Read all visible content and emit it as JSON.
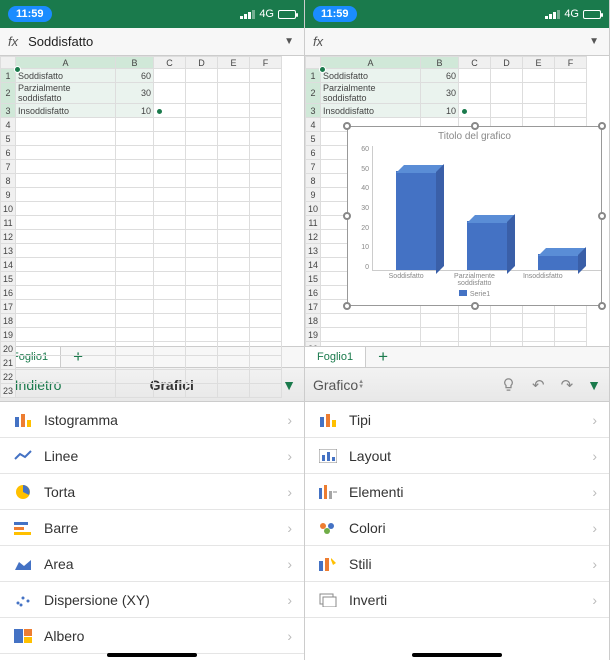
{
  "status": {
    "time": "11:59",
    "network": "4G"
  },
  "left": {
    "formula": "Soddisfatto",
    "sheet_name": "Foglio1",
    "columns": [
      "A",
      "B",
      "C",
      "D",
      "E",
      "F"
    ],
    "rows_visible": 23,
    "cells": {
      "A1": "Soddisfatto",
      "B1": "60",
      "A2": "Parzialmente soddisfatto",
      "B2": "30",
      "A3": "Insoddisfatto",
      "B3": "10"
    },
    "panel": {
      "back": "Indietro",
      "title": "Grafici",
      "items": [
        {
          "icon": "histogram",
          "label": "Istogramma"
        },
        {
          "icon": "line",
          "label": "Linee"
        },
        {
          "icon": "pie",
          "label": "Torta"
        },
        {
          "icon": "bar",
          "label": "Barre"
        },
        {
          "icon": "area",
          "label": "Area"
        },
        {
          "icon": "scatter",
          "label": "Dispersione (XY)"
        },
        {
          "icon": "tree",
          "label": "Albero"
        }
      ]
    }
  },
  "right": {
    "formula": "",
    "sheet_name": "Foglio1",
    "columns": [
      "A",
      "B",
      "C",
      "D",
      "E",
      "F"
    ],
    "rows_visible": 23,
    "cells": {
      "A1": "Soddisfatto",
      "B1": "60",
      "A2": "Parzialmente soddisfatto",
      "B2": "30",
      "A3": "Insoddisfatto",
      "B3": "10"
    },
    "chart": {
      "title": "Titolo del grafico",
      "legend": "Serie1"
    },
    "panel": {
      "title": "Grafico",
      "items": [
        {
          "icon": "histogram",
          "label": "Tipi"
        },
        {
          "icon": "layout",
          "label": "Layout"
        },
        {
          "icon": "elements",
          "label": "Elementi"
        },
        {
          "icon": "colors",
          "label": "Colori"
        },
        {
          "icon": "styles",
          "label": "Stili"
        },
        {
          "icon": "invert",
          "label": "Inverti"
        }
      ]
    }
  },
  "chart_data": {
    "type": "bar",
    "title": "Titolo del grafico",
    "categories": [
      "Soddisfatto",
      "Parzialmente soddisfatto",
      "Insoddisfatto"
    ],
    "series": [
      {
        "name": "Serie1",
        "values": [
          60,
          30,
          10
        ]
      }
    ],
    "ylim": [
      0,
      70
    ],
    "yticks": [
      0,
      10,
      20,
      30,
      40,
      50,
      60
    ],
    "style": "3d",
    "color": "#4472c4"
  }
}
